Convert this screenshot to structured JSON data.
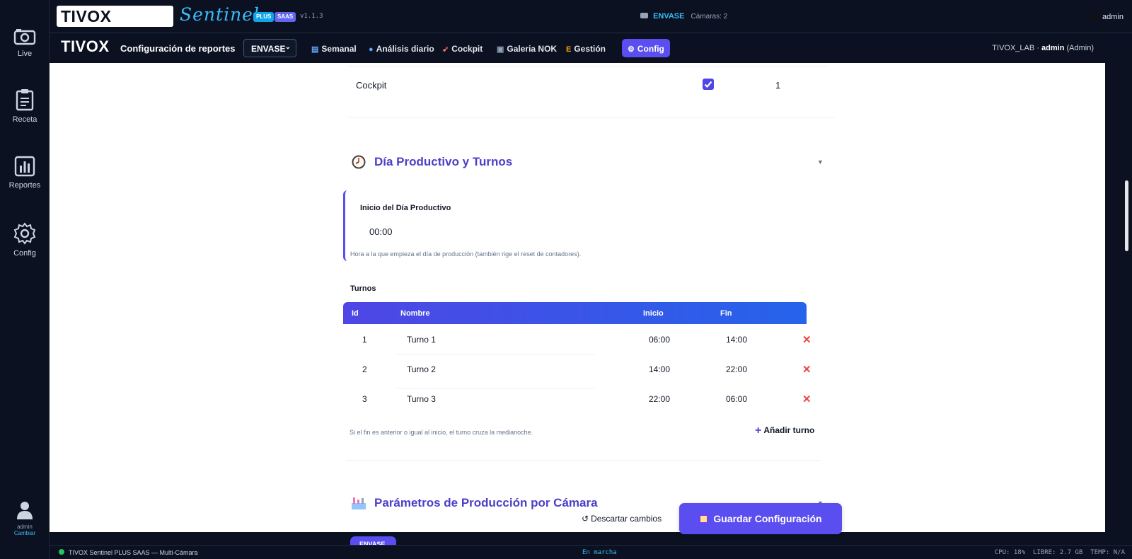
{
  "sidebar": {
    "items": [
      {
        "label": "Live",
        "icon": "camera-icon"
      },
      {
        "label": "Receta",
        "icon": "clipboard-icon"
      },
      {
        "label": "Reportes",
        "icon": "bar-chart-icon"
      },
      {
        "label": "Config",
        "icon": "gear-icon"
      }
    ],
    "user": {
      "name": "admin",
      "action": "Cambiar"
    }
  },
  "topbar": {
    "logo": "TIVOX",
    "product": "Sentinel",
    "badge_plus": "PLUS",
    "badge_saas": "SAAS",
    "version": "v1.1.3",
    "line": "ENVASE",
    "cameras": "Cámaras: 2",
    "user": "admin"
  },
  "navbar": {
    "logo": "TIVOX",
    "title": "Configuración de reportes",
    "line_select": "ENVASE",
    "tabs": [
      {
        "label": "Semanal",
        "icon": "chart-icon",
        "active": false
      },
      {
        "label": "Análisis diario",
        "icon": "magnifier-icon",
        "active": false
      },
      {
        "label": "Cockpit",
        "icon": "rocket-icon",
        "active": false
      },
      {
        "label": "Galeria NOK",
        "icon": "gallery-icon",
        "active": false
      },
      {
        "label": "Gestión",
        "icon": "ledger-icon",
        "active": false
      },
      {
        "label": "Config",
        "icon": "gear-icon",
        "active": true
      }
    ],
    "tenant": "TIVOX_LAB",
    "separator": "·",
    "user": "admin",
    "role": "(Admin)"
  },
  "main": {
    "cockpit_row": {
      "label": "Cockpit",
      "checked": true,
      "order": "1"
    },
    "dia_section": {
      "title": "Día Productivo y Turnos",
      "start_label": "Inicio del Día Productivo",
      "start_value": "00:00",
      "start_hint": "Hora a la que empieza el día de producción (también rige el reset de contadores).",
      "shifts_title": "Turnos",
      "columns": [
        "Id",
        "Nombre",
        "Inicio",
        "Fin"
      ],
      "rows": [
        {
          "id": "1",
          "name": "Turno 1",
          "start": "06:00",
          "end": "14:00"
        },
        {
          "id": "2",
          "name": "Turno 2",
          "start": "14:00",
          "end": "22:00"
        },
        {
          "id": "3",
          "name": "Turno 3",
          "start": "22:00",
          "end": "06:00"
        }
      ],
      "footer_hint": "Si el fin es anterior o igual al inicio, el turno cruza la medianoche.",
      "add_label": "Añadir turno"
    },
    "params_section": {
      "title": "Parámetros de Producción por Cámara",
      "tab_active": "ENVASE"
    },
    "discard_label": "Descartar cambios",
    "save_label": "Guardar Configuración"
  },
  "statusbar": {
    "left": "TIVOX Sentinel PLUS SAAS — Multi-Cámara",
    "center": "En marcha",
    "right": "CPU: 18%  LIBRE: 2.7 GB  TEMP: N/A"
  },
  "colors": {
    "accent": "#5b4ef0",
    "dark": "#0b1120",
    "danger": "#ef4444",
    "link": "#38bdf8"
  }
}
